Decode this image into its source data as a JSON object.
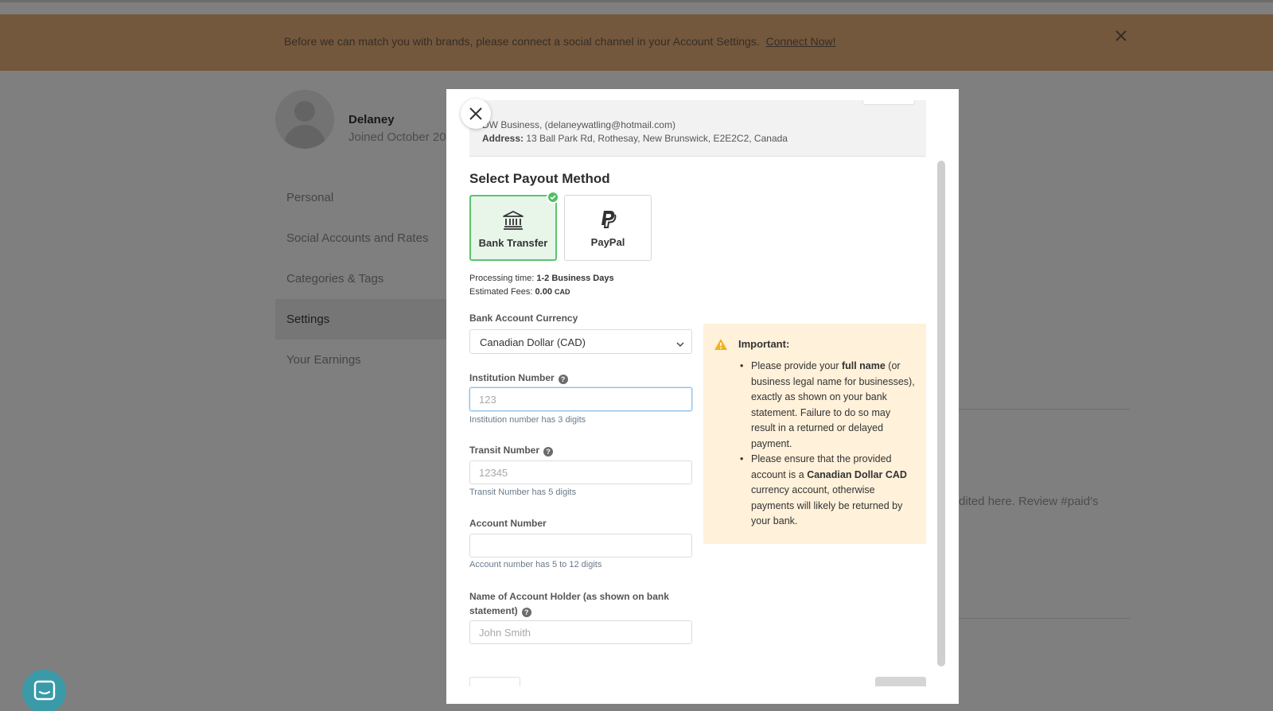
{
  "banner": {
    "text": "Before we can match you with brands, please connect a social channel in your Account Settings.",
    "link": "Connect Now!"
  },
  "profile": {
    "name": "Delaney",
    "joined": "Joined October 20"
  },
  "sidebar": {
    "items": [
      {
        "label": "Personal"
      },
      {
        "label": "Social Accounts and Rates"
      },
      {
        "label": "Categories & Tags"
      },
      {
        "label": "Settings"
      },
      {
        "label": "Your Earnings"
      }
    ]
  },
  "background": {
    "partial_text": "dited here. Review #paid's"
  },
  "modal": {
    "info": {
      "business_line": "DW Business, (delaneywatling@hotmail.com)",
      "address_label": "Address:",
      "address_value": "13 Ball Park Rd, Rothesay, New Brunswick, E2E2C2, Canada"
    },
    "title": "Select Payout Method",
    "methods": [
      {
        "label": "Bank Transfer",
        "icon": "bank-icon",
        "selected": true
      },
      {
        "label": "PayPal",
        "icon": "paypal-icon",
        "selected": false
      }
    ],
    "processing_label": "Processing time:",
    "processing_value": "1-2 Business Days",
    "fees_label": "Estimated Fees:",
    "fees_value": "0.00",
    "fees_currency": "CAD",
    "currency_label": "Bank Account Currency",
    "currency_value": "Canadian Dollar (CAD)",
    "institution": {
      "label": "Institution Number",
      "placeholder": "123",
      "hint": "Institution number has 3 digits"
    },
    "transit": {
      "label": "Transit Number",
      "placeholder": "12345",
      "hint": "Transit Number has 5 digits"
    },
    "account": {
      "label": "Account Number",
      "placeholder": "",
      "hint": "Account number has 5 to 12 digits"
    },
    "holder": {
      "label_line1": "Name of Account Holder (as shown on bank",
      "label_line2": "statement)",
      "placeholder": "John Smith"
    },
    "help_glyph": "?",
    "notice": {
      "title": "Important:",
      "b1_pre": "Please provide your ",
      "b1_bold": "full name",
      "b1_post": " (or business legal name for businesses), exactly as shown on your bank statement. Failure to do so may result in a returned or delayed payment.",
      "b2_pre": "Please ensure that the provided account is a ",
      "b2_bold": "Canadian Dollar CAD",
      "b2_post": " currency account, otherwise payments will likely be returned by your bank."
    }
  },
  "colors": {
    "banner": "#e8b07a",
    "selected_border": "#5cc46e",
    "notice_bg": "#fff1da",
    "chat": "#3a9aa8"
  }
}
